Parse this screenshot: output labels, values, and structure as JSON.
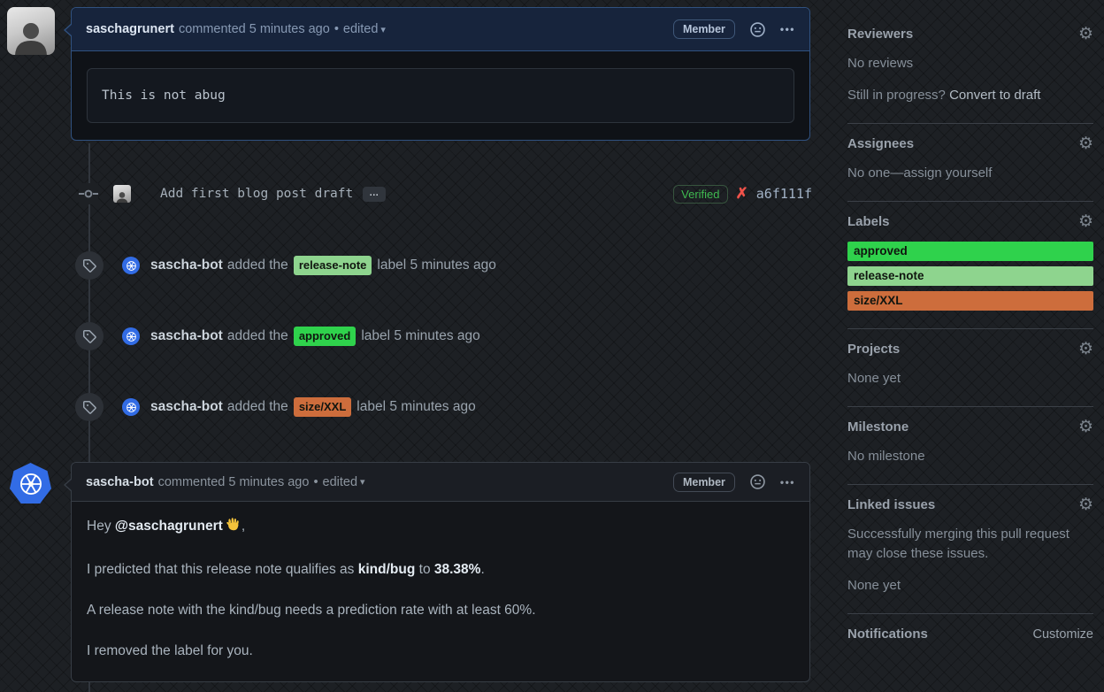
{
  "icons": {
    "gear": "⚙",
    "kebab": "•••",
    "failed_x": "✗",
    "expand": "…",
    "dropdown_caret": "▾",
    "separator": "•"
  },
  "colors": {
    "author_highlight_border": "#30517f",
    "kubernetes_blue": "#326ce5",
    "verified_green": "#3fb950",
    "failed_red": "#f0524a"
  },
  "comment1": {
    "author": "saschagrunert",
    "action": "commented 5 minutes ago",
    "edited_label": "edited",
    "member_badge": "Member",
    "code_text": "This is not abug"
  },
  "commit": {
    "message": "Add first blog post draft",
    "verified_badge": "Verified",
    "sha": "a6f111f"
  },
  "events": [
    {
      "actor": "sascha-bot",
      "action_pre": "added the",
      "label": "release-note",
      "label_color": "#8ed48e",
      "action_post": "label 5 minutes ago"
    },
    {
      "actor": "sascha-bot",
      "action_pre": "added the",
      "label": "approved",
      "label_color": "#2fd24c",
      "action_post": "label 5 minutes ago"
    },
    {
      "actor": "sascha-bot",
      "action_pre": "added the",
      "label": "size/XXL",
      "label_color": "#cd6d3c",
      "action_post": "label 5 minutes ago"
    }
  ],
  "comment2": {
    "author": "sascha-bot",
    "action": "commented 5 minutes ago",
    "edited_label": "edited",
    "member_badge": "Member",
    "p1_pre": "Hey ",
    "p1_mention": "@saschagrunert",
    "p1_post": ",",
    "p2_pre": "I predicted that this release note qualifies as ",
    "p2_bold1": "kind/bug",
    "p2_mid": " to ",
    "p2_bold2": "38.38%",
    "p2_post": ".",
    "p3": "A release note with the kind/bug needs a prediction rate with at least 60%.",
    "p4": "I removed the label for you."
  },
  "sidebar": {
    "reviewers": {
      "title": "Reviewers",
      "empty": "No reviews",
      "hint_pre": "Still in progress? ",
      "hint_link": "Convert to draft"
    },
    "assignees": {
      "title": "Assignees",
      "empty_pre": "No one—",
      "empty_link": "assign yourself"
    },
    "labels": {
      "title": "Labels",
      "items": [
        {
          "name": "approved",
          "color": "#2fd24c"
        },
        {
          "name": "release-note",
          "color": "#8ed48e"
        },
        {
          "name": "size/XXL",
          "color": "#cd6d3c"
        }
      ]
    },
    "projects": {
      "title": "Projects",
      "empty": "None yet"
    },
    "milestone": {
      "title": "Milestone",
      "empty": "No milestone"
    },
    "linked_issues": {
      "title": "Linked issues",
      "description": "Successfully merging this pull request may close these issues.",
      "empty": "None yet"
    },
    "notifications": {
      "title": "Notifications",
      "action": "Customize"
    }
  }
}
